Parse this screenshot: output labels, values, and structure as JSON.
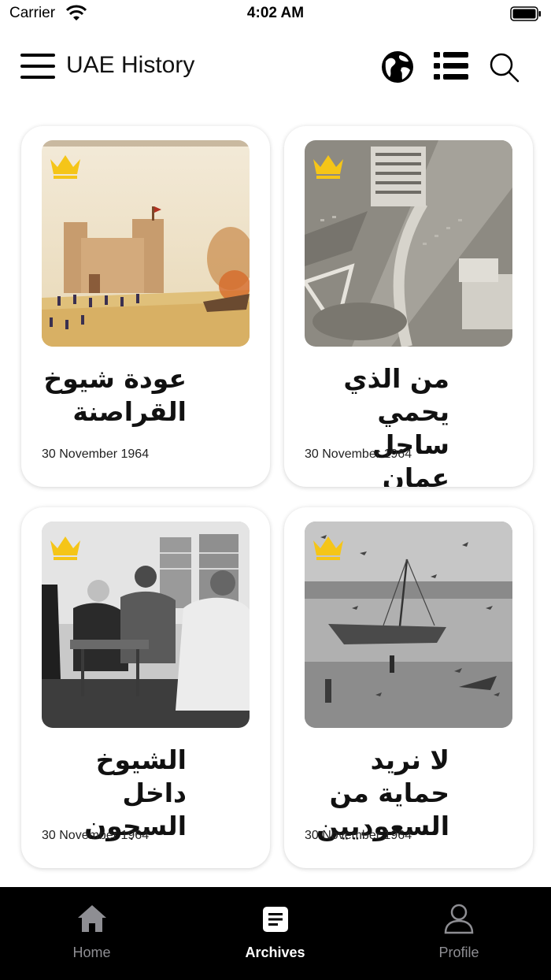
{
  "status_bar": {
    "carrier": "Carrier",
    "time": "4:02 AM"
  },
  "header": {
    "title": "UAE History",
    "icons": [
      "menu-icon",
      "globe-icon",
      "list-icon",
      "search-icon"
    ]
  },
  "articles": [
    {
      "title": "عودة شيوخ القراصنة",
      "date": "30 November 1964",
      "premium": true,
      "image": "fort-battle-painting"
    },
    {
      "title": "من الذي يحمي ساحل عمان",
      "date": "30 November 1964",
      "premium": true,
      "image": "aerial-city-photo"
    },
    {
      "title": "الشيوخ داخل السجون",
      "date": "30 November 1964",
      "premium": true,
      "image": "majlis-meeting-photo"
    },
    {
      "title": "لا نريد حماية من السعوديين",
      "date": "30 November 1964",
      "premium": true,
      "image": "dhow-locusts-photo"
    }
  ],
  "tabbar": {
    "tabs": [
      {
        "label": "Home",
        "icon": "home-icon",
        "active": false
      },
      {
        "label": "Archives",
        "icon": "archive-icon",
        "active": true
      },
      {
        "label": "Profile",
        "icon": "person-icon",
        "active": false
      }
    ]
  },
  "colors": {
    "crown": "#F5C518",
    "tabbar_bg": "#000000",
    "tab_inactive": "#8E8E93",
    "tab_active": "#FFFFFF"
  }
}
